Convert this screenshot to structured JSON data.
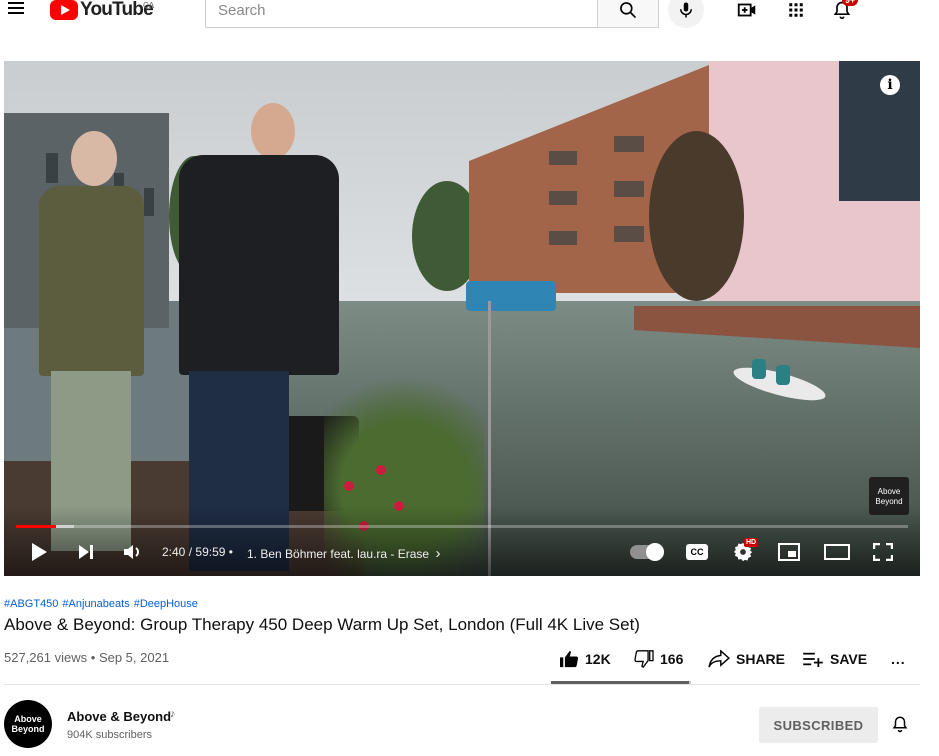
{
  "header": {
    "logo_text": "YouTube",
    "logo_country": "CA",
    "search_placeholder": "Search",
    "notification_count": "9+",
    "icons": [
      "menu-icon",
      "search-icon",
      "microphone-icon",
      "create-video-icon",
      "apps-grid-icon",
      "bell-icon"
    ]
  },
  "player": {
    "current_time": "2:40",
    "duration": "59:59",
    "time_separator": "/",
    "chapter_separator": "•",
    "chapter": "1. Ben Böhmer feat. lau.ra - Erase",
    "chapter_arrow": "›",
    "progress_fraction": 0.045,
    "buffer_fraction": 0.065,
    "cc_label": "CC",
    "hd_badge": "HD",
    "watermark_text": "Above Beyond",
    "info_glyph": "i",
    "accent_color": "#ff0000"
  },
  "video": {
    "hashtags": [
      "#ABGT450",
      "#Anjunabeats",
      "#DeepHouse"
    ],
    "title": "Above & Beyond: Group Therapy 450 Deep Warm Up Set, London (Full 4K Live Set)",
    "views": "527,261 views",
    "meta_separator": "•",
    "date": "Sep 5, 2021",
    "like_count": "12K",
    "dislike_count": "166",
    "share_label": "SHARE",
    "save_label": "SAVE",
    "more_glyph": "...",
    "like_ratio": 0.986
  },
  "channel": {
    "name": "Above & Beyond",
    "music_note": "♪",
    "subscribers": "904K subscribers",
    "avatar_text": "Above Beyond",
    "subscribed_label": "SUBSCRIBED"
  }
}
